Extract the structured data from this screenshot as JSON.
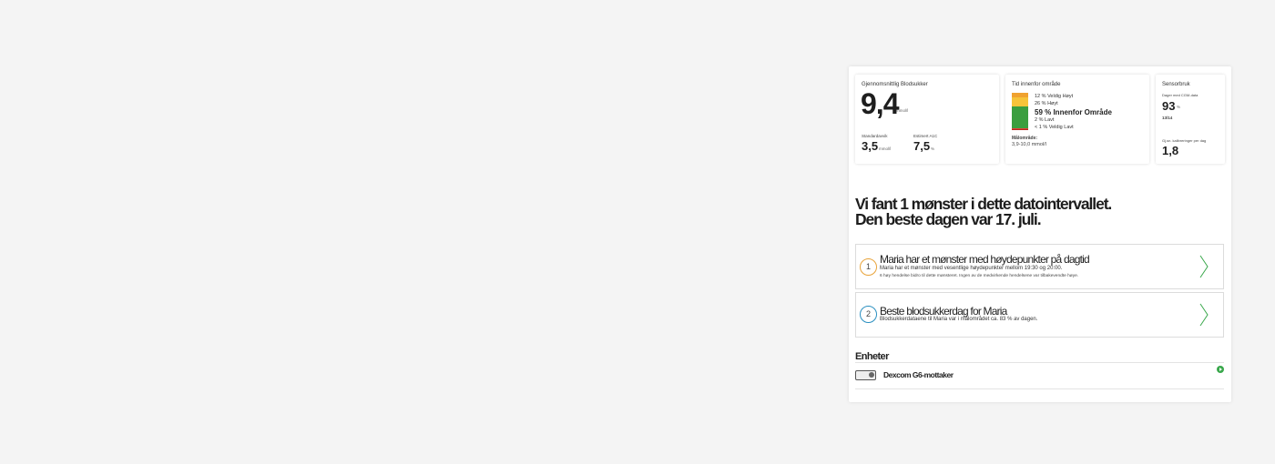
{
  "summary": {
    "avg_glucose": {
      "label": "Gjennomsnittlig Blodsukker",
      "value": "9,4",
      "unit": "mmol/l"
    },
    "std_dev": {
      "label": "Standardavvik",
      "value": "3,5",
      "unit": "mmol/l"
    },
    "a1c": {
      "label": "Estimert A1C",
      "value": "7,5",
      "unit": "%"
    }
  },
  "time_in_range": {
    "title": "Tid innenfor område",
    "rows": [
      {
        "label": "12 % Veldig Høyt",
        "fraction": 0.12,
        "color": "#f0a230"
      },
      {
        "label": "26 % Høyt",
        "fraction": 0.26,
        "color": "#f6c43a"
      },
      {
        "label": "59 % Innenfor Område",
        "fraction": 0.59,
        "color": "#3a9e3f"
      },
      {
        "label": "2 % Lavt",
        "fraction": 0.02,
        "color": "#e2443c"
      },
      {
        "label": "< 1 % Veldig Lavt",
        "fraction": 0.01,
        "color": "#b3261e"
      }
    ],
    "target_label": "Målområde:",
    "target_range": "3,9-10,0 mmol/l"
  },
  "sensor": {
    "title": "Sensorbruk",
    "days_label": "Dager med CGM-data",
    "days_value": "93",
    "days_unit": "%",
    "days_fraction": "13/14",
    "cal_label": "Gj.sn. kalibreringer per dag",
    "cal_value": "1,8"
  },
  "headline": {
    "line1": "Vi fant 1 mønster i dette datointervallet.",
    "line2": "Den beste dagen var 17. juli."
  },
  "patterns": [
    {
      "number": "1",
      "title": "Maria har et mønster med høydepunkter på dagtid",
      "subtitle": "Maria har et mønster med vesentlige høydepunkter mellom 19:30 og 20:00.",
      "detail": "6 høy hendelse bidro til dette mønsteret. Ingen av de medvirkende hendelsene var tilbakevendte høye.",
      "ring_color": "#e8a33a"
    },
    {
      "number": "2",
      "title": "Beste blodsukkerdag for Maria",
      "subtitle": "Blodsukkerdataene til Maria var i målområdet ca. 83 % av dagen.",
      "detail": "",
      "ring_color": "#2a8fc0"
    }
  ],
  "devices": {
    "title": "Enheter",
    "items": [
      {
        "name": "Dexcom G6-mottaker",
        "icon": "receiver-icon"
      }
    ]
  },
  "colors": {
    "chevron": "#3aa84c",
    "status": "#3aa84c"
  }
}
